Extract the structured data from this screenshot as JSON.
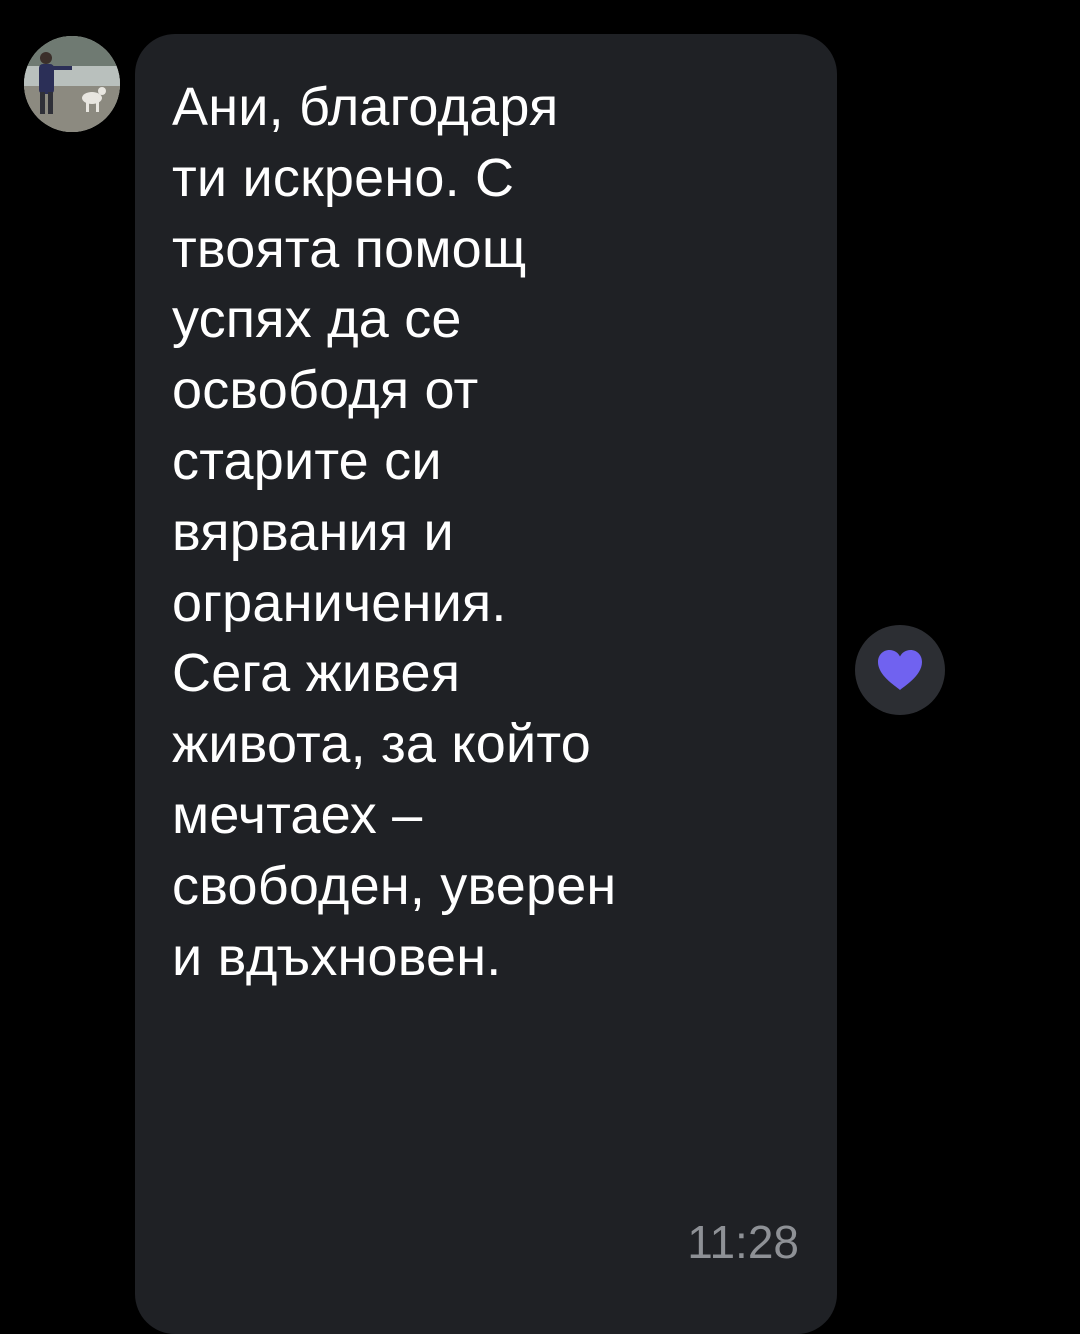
{
  "message": {
    "text": "Ани, благодаря\nти искрено. С\nтвоята помощ\nуспях да се\nосвободя от\nстарите си\nвярвания и\nограничения.\nСега живея\nживота, за който\nмечтаех –\nсвободен, уверен\nи вдъхновен.",
    "time": "11:28"
  },
  "sender": {
    "avatar_icon": "profile-photo"
  },
  "reaction": {
    "icon": "heart-icon",
    "color": "#7062f0"
  },
  "colors": {
    "background": "#000000",
    "bubble": "#1f2125",
    "text": "#ffffff",
    "timestamp": "#8e9196"
  }
}
